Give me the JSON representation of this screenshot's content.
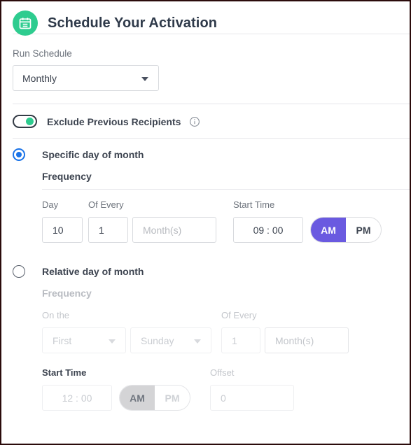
{
  "header": {
    "icon": "calendar-icon",
    "title": "Schedule Your Activation",
    "icon_bg": "#2ecc8f"
  },
  "run_schedule": {
    "label": "Run Schedule",
    "value": "Monthly",
    "caret": "chevron-down-icon"
  },
  "exclude_toggle": {
    "label": "Exclude Previous Recipients",
    "state": "on",
    "knob_color": "#2ecc8f",
    "info_icon": "info-icon"
  },
  "specific_day": {
    "radio_label": "Specific day of month",
    "selected": true,
    "accent": "#1a73e8",
    "frequency_heading": "Frequency",
    "labels": {
      "day": "Day",
      "of_every": "Of Every",
      "start_time": "Start Time"
    },
    "day_value": "10",
    "every_value": "1",
    "months_placeholder": "Month(s)",
    "time_value": "09 : 00",
    "ampm": {
      "am": "AM",
      "pm": "PM",
      "selected": "AM",
      "active_color": "#6a5ae0"
    }
  },
  "relative_day": {
    "radio_label": "Relative day of month",
    "selected": false,
    "frequency_heading": "Frequency",
    "labels": {
      "on_the": "On the",
      "of_every": "Of Every",
      "start_time": "Start Time",
      "offset": "Offset"
    },
    "on_the_value": "First",
    "weekday_value": "Sunday",
    "every_value": "1",
    "months_placeholder": "Month(s)",
    "time_value": "12 : 00",
    "offset_placeholder": "0",
    "ampm": {
      "am": "AM",
      "pm": "PM",
      "selected": "AM",
      "active_color": "#d4d4d6"
    }
  }
}
